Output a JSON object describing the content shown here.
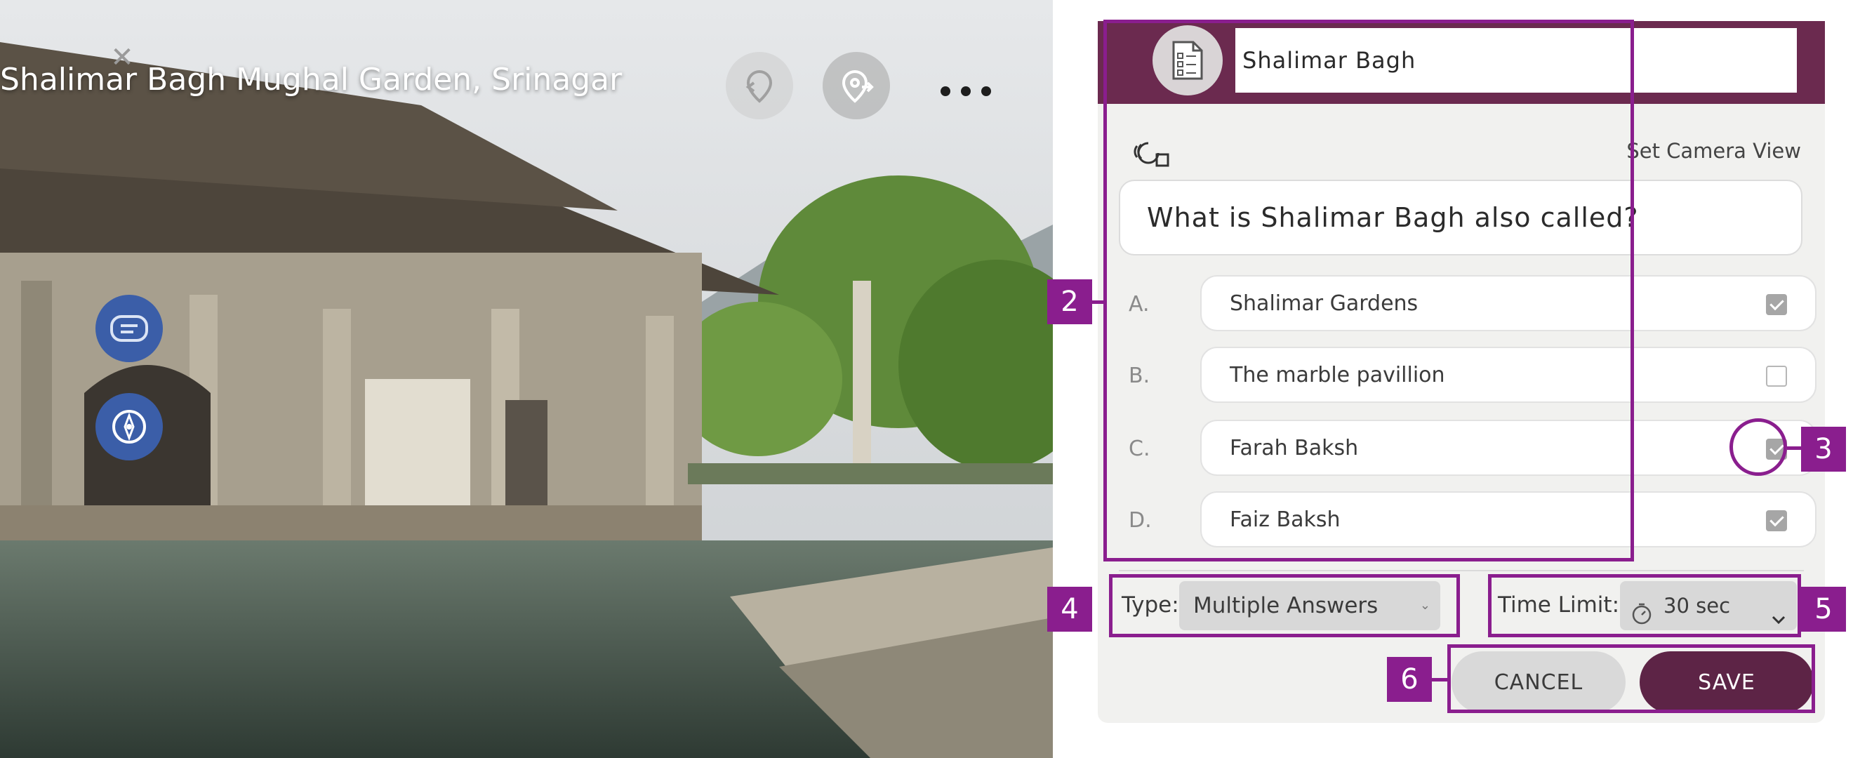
{
  "scene": {
    "location_title": "Shalimar Bagh Mughal Garden, Srinagar",
    "icons": {
      "close": "close-icon",
      "undo_location": "location-undo-icon",
      "next_location": "location-forward-icon",
      "more": "more-dots-icon",
      "chat": "chat-icon",
      "compass": "compass-icon"
    },
    "close_glyph": "✕"
  },
  "editor": {
    "header_icon": "quiz-document-icon",
    "title_value": "Shalimar Bagh",
    "camera_icon": "camera-view-icon",
    "set_camera_label": "Set Camera View",
    "question": "What is Shalimar Bagh also called?",
    "answers": [
      {
        "letter": "A.",
        "text": "Shalimar Gardens",
        "checked": true
      },
      {
        "letter": "B.",
        "text": "The marble pavillion",
        "checked": false
      },
      {
        "letter": "C.",
        "text": "Farah Baksh",
        "checked": true
      },
      {
        "letter": "D.",
        "text": "Faiz Baksh",
        "checked": true
      }
    ],
    "type_label": "Type:",
    "type_value": "Multiple Answers",
    "type_caret": "⌄",
    "time_label": "Time Limit:",
    "time_value": "30 sec",
    "cancel_label": "CANCEL",
    "save_label": "SAVE"
  },
  "callouts": [
    "2",
    "3",
    "4",
    "5",
    "6"
  ],
  "colors": {
    "header": "#6b2a4f",
    "save": "#5d2446",
    "callout": "#8a1e8e",
    "scene_button": "#3b5ea8"
  }
}
